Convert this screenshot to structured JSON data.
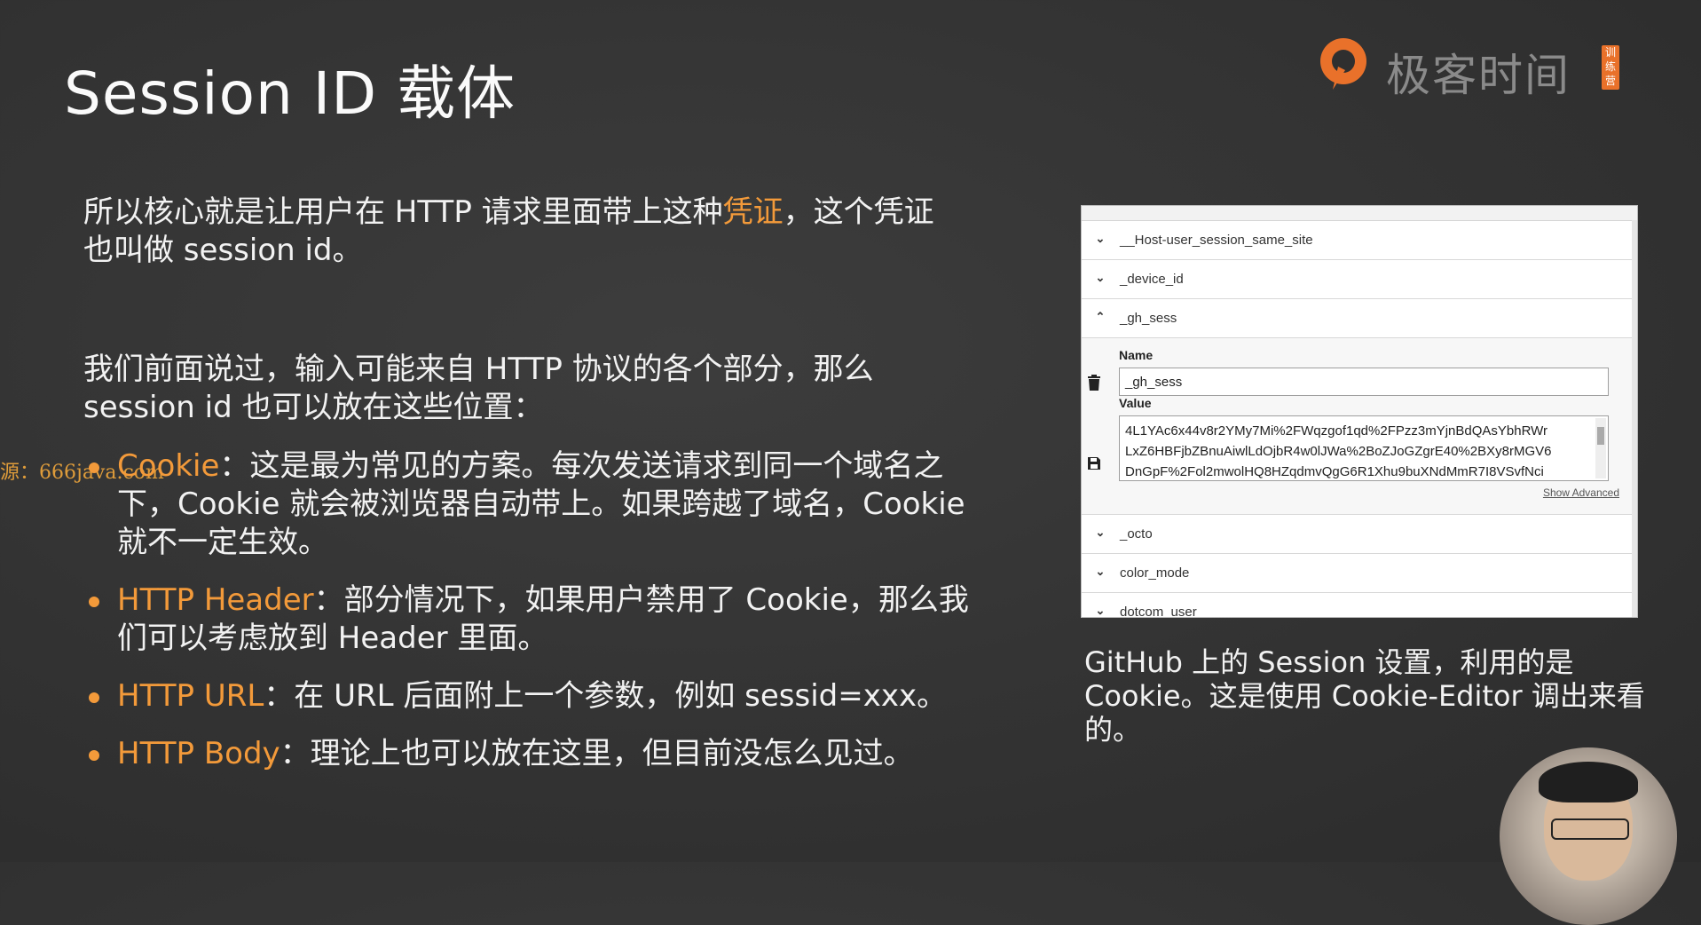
{
  "slide": {
    "title": "Session ID 载体",
    "intro_prefix": "所以核心就是让用户在 HTTP 请求里面带上这种",
    "intro_highlight": "凭证",
    "intro_suffix": "，这个凭证也叫做 session id。",
    "para2": "我们前面说过，输入可能来自 HTTP 协议的各个部分，那么 session id 也可以放在这些位置：",
    "bullets": [
      {
        "term": "Cookie",
        "text": "：这是最为常见的方案。每次发送请求到同一个域名之下，Cookie 就会被浏览器自动带上。如果跨越了域名，Cookie 就不一定生效。"
      },
      {
        "term": "HTTP Header",
        "text": "：部分情况下，如果用户禁用了 Cookie，那么我们可以考虑放到 Header 里面。"
      },
      {
        "term": "HTTP URL",
        "text": "：在 URL 后面附上一个参数，例如 sessid=xxx。"
      },
      {
        "term": "HTTP Body",
        "text": "：理论上也可以放在这里，但目前没怎么见过。"
      }
    ],
    "caption": "GitHub 上的 Session 设置，利用的是 Cookie。这是使用 Cookie-Editor 调出来看的。",
    "watermark": "源：666java.com"
  },
  "logo": {
    "brand": "极客时间",
    "badge": "训练营"
  },
  "colors": {
    "accent": "#f39a3a",
    "background": "#333333"
  },
  "cookie_editor": {
    "rows_before": [
      {
        "name": "__Host-user_session_same_site",
        "icon": "chevron-down-icon"
      },
      {
        "name": "_device_id",
        "icon": "chevron-down-icon"
      },
      {
        "name": "_gh_sess",
        "icon": "chevron-up-icon"
      }
    ],
    "expanded": {
      "name_label": "Name",
      "name_value": "_gh_sess",
      "value_label": "Value",
      "value_lines": [
        "4L1YAc6x44v8r2YMy7Mi%2FWqzgof1qd%2FPzz3mYjnBdQAsYbhRWr",
        "LxZ6HBFjbZBnuAiwlLdOjbR4w0lJWa%2BoZJoGZgrE40%2BXy8rMGV6",
        "DnGpF%2Fol2mwolHQ8HZqdmvQgG6R1Xhu9buXNdMmR7I8VSvfNci"
      ],
      "show_advanced": "Show Advanced"
    },
    "rows_after": [
      {
        "name": "_octo",
        "icon": "chevron-down-icon"
      },
      {
        "name": "color_mode",
        "icon": "chevron-down-icon"
      },
      {
        "name": "dotcom_user",
        "icon": "chevron-down-icon"
      }
    ]
  }
}
